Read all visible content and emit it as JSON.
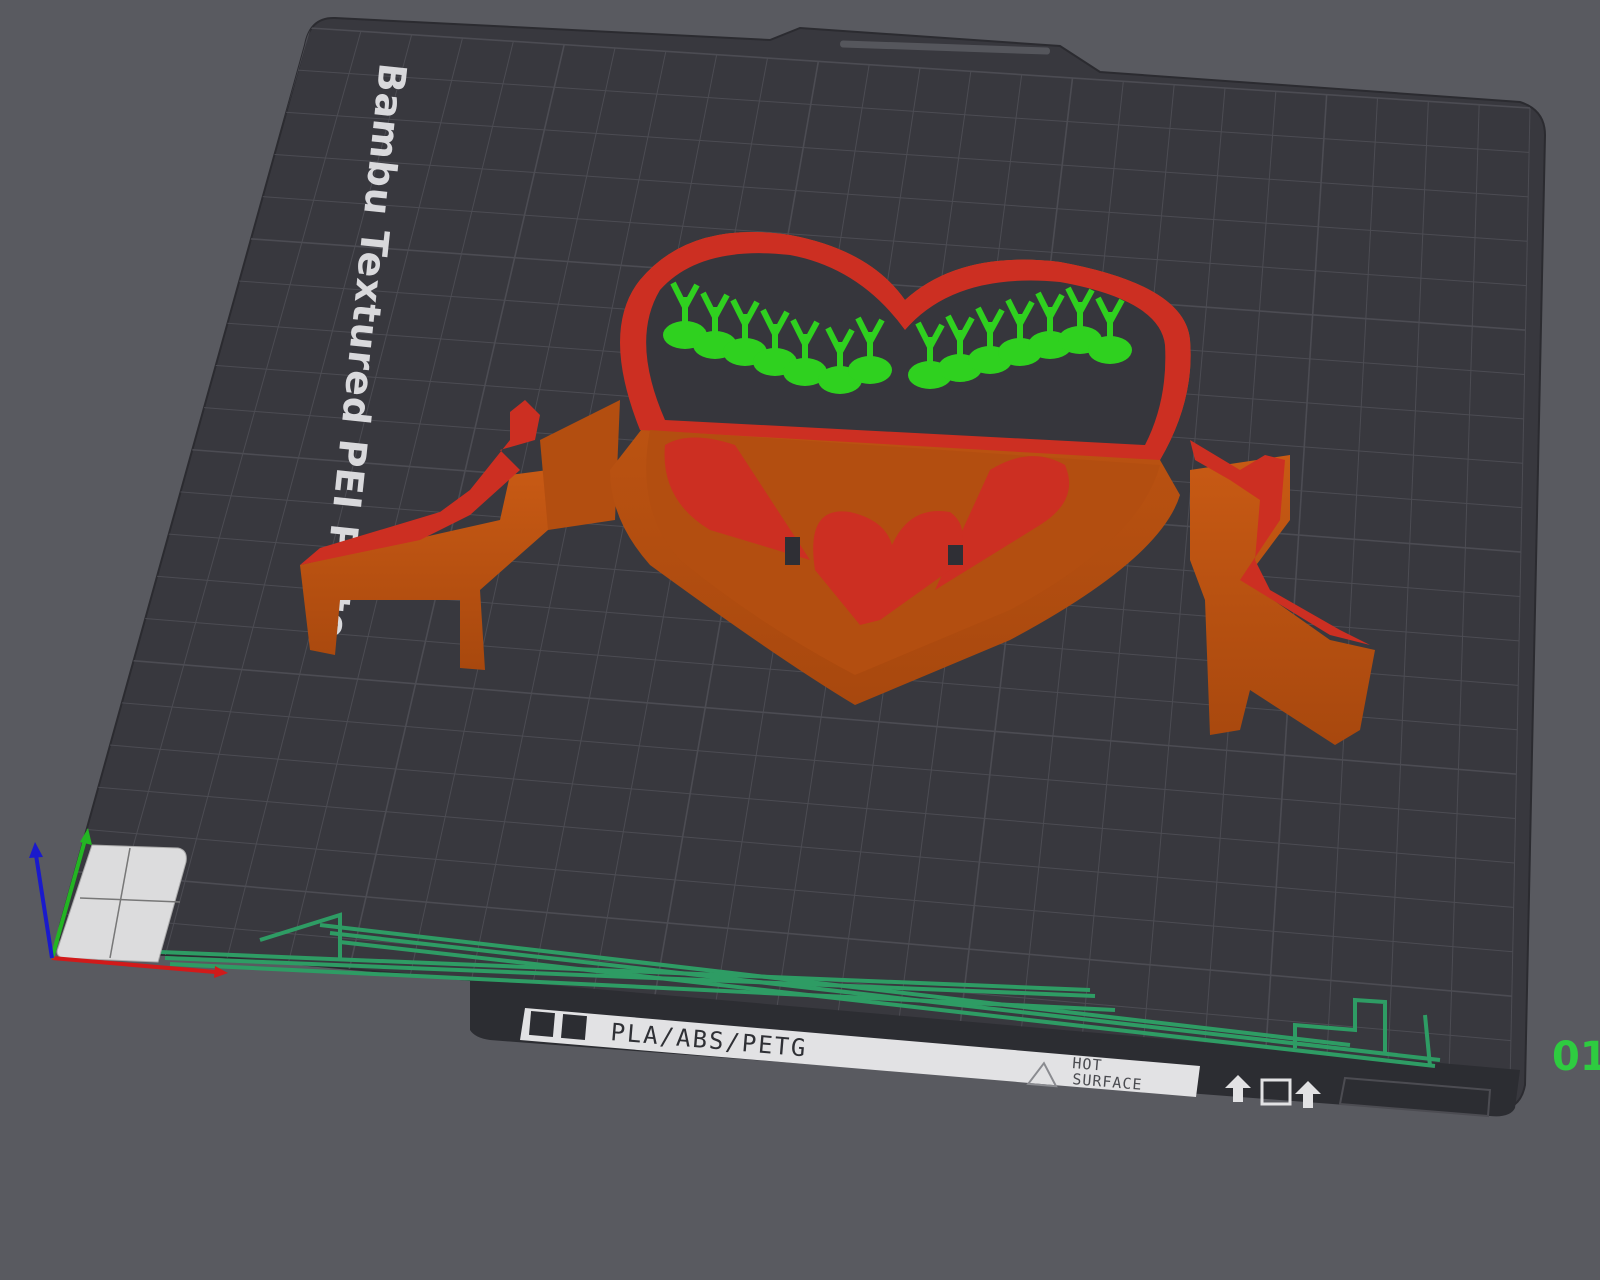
{
  "viewport": {
    "plate_name": "Bambu Textured PEI Plate",
    "material_label": "PLA/ABS/PETG",
    "hot_surface_label_line1": "HOT",
    "hot_surface_label_line2": "SURFACE",
    "plate_index": "01"
  },
  "colors": {
    "background": "#595a60",
    "plate": "#38383e",
    "grid": "#4c4c53",
    "model_wall": "#c2560f",
    "model_top": "#cc2f22",
    "support": "#2fd11f",
    "purge_line": "#2e9c64",
    "axis_x": "#d11a1a",
    "axis_y": "#23b523",
    "axis_z": "#1a1acc"
  },
  "icons": [
    "bed-tag-icon",
    "hot-surface-warning-icon",
    "arrow-up-icon",
    "plate-outline-icon"
  ]
}
